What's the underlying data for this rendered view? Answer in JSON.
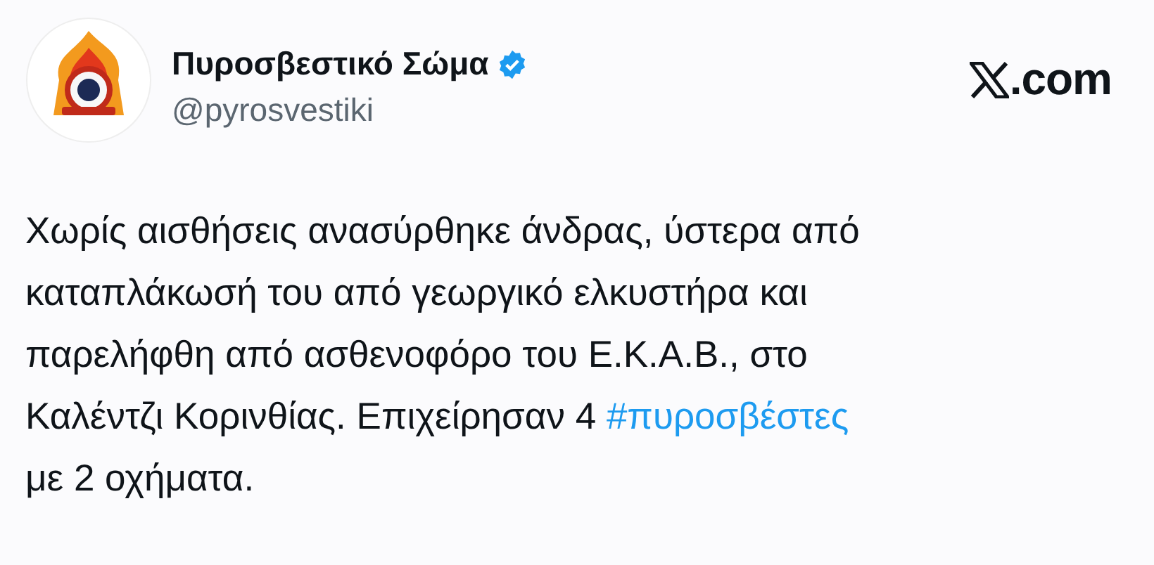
{
  "author": {
    "name": "Πυροσβεστικό Σώμα",
    "verified": true,
    "handle": "@pyrosvestiki"
  },
  "site": {
    "suffix": ".com"
  },
  "body": {
    "lines": [
      [
        {
          "kind": "text",
          "text": "Χωρίς αισθήσεις ανασύρθηκε άνδρας, ύστερα από"
        }
      ],
      [
        {
          "kind": "text",
          "text": "καταπλάκωσή του από γεωργικό ελκυστήρα και"
        }
      ],
      [
        {
          "kind": "text",
          "text": "παρελήφθη από ασθενοφόρο του Ε.Κ.Α.Β., στο"
        }
      ],
      [
        {
          "kind": "text",
          "text": "Καλέντζι Κορινθίας. Επιχείρησαν 4 "
        },
        {
          "kind": "hashtag",
          "text": "#πυροσβέστες"
        }
      ],
      [
        {
          "kind": "text",
          "text": "με 2 οχήματα."
        }
      ]
    ]
  }
}
